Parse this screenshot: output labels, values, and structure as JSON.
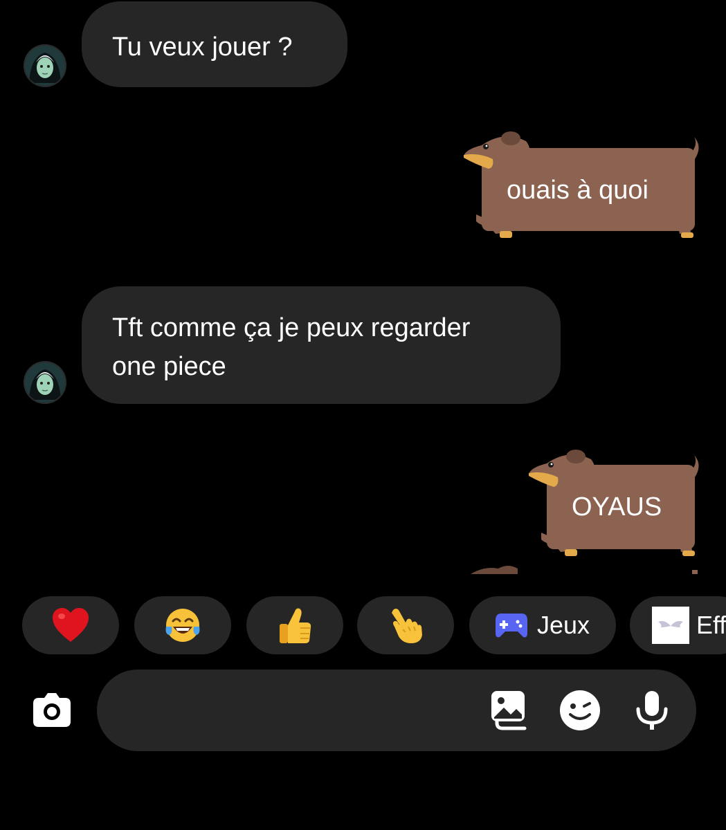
{
  "conversation": {
    "messages": [
      {
        "direction": "incoming",
        "text": "Tu veux jouer ?"
      },
      {
        "direction": "outgoing",
        "text": "ouais à quoi",
        "style": "dachshund-sticker"
      },
      {
        "direction": "incoming",
        "lines": [
          "Tft comme ça je peux regarder",
          "one piece"
        ]
      },
      {
        "direction": "outgoing",
        "text": "OYAUS",
        "style": "dachshund-sticker"
      }
    ]
  },
  "quick_reactions": [
    {
      "icon": "red-heart-emoji",
      "label": ""
    },
    {
      "icon": "tears-of-joy-emoji",
      "label": ""
    },
    {
      "icon": "thumbs-up-emoji",
      "label": ""
    },
    {
      "icon": "pointing-finger-emoji",
      "label": ""
    },
    {
      "icon": "game-controller-icon",
      "label": "Jeux"
    },
    {
      "icon": "effects-wings-icon",
      "label": "Eff"
    }
  ],
  "composer": {
    "placeholder": "",
    "icons": [
      "camera-icon",
      "gallery-icon",
      "sticker-icon",
      "microphone-icon"
    ]
  },
  "colors": {
    "background": "#000000",
    "bubble_incoming": "#262626",
    "dog_body": "#8b6350",
    "dog_muzzle": "#e3a94a",
    "controller": "#5865f2"
  }
}
